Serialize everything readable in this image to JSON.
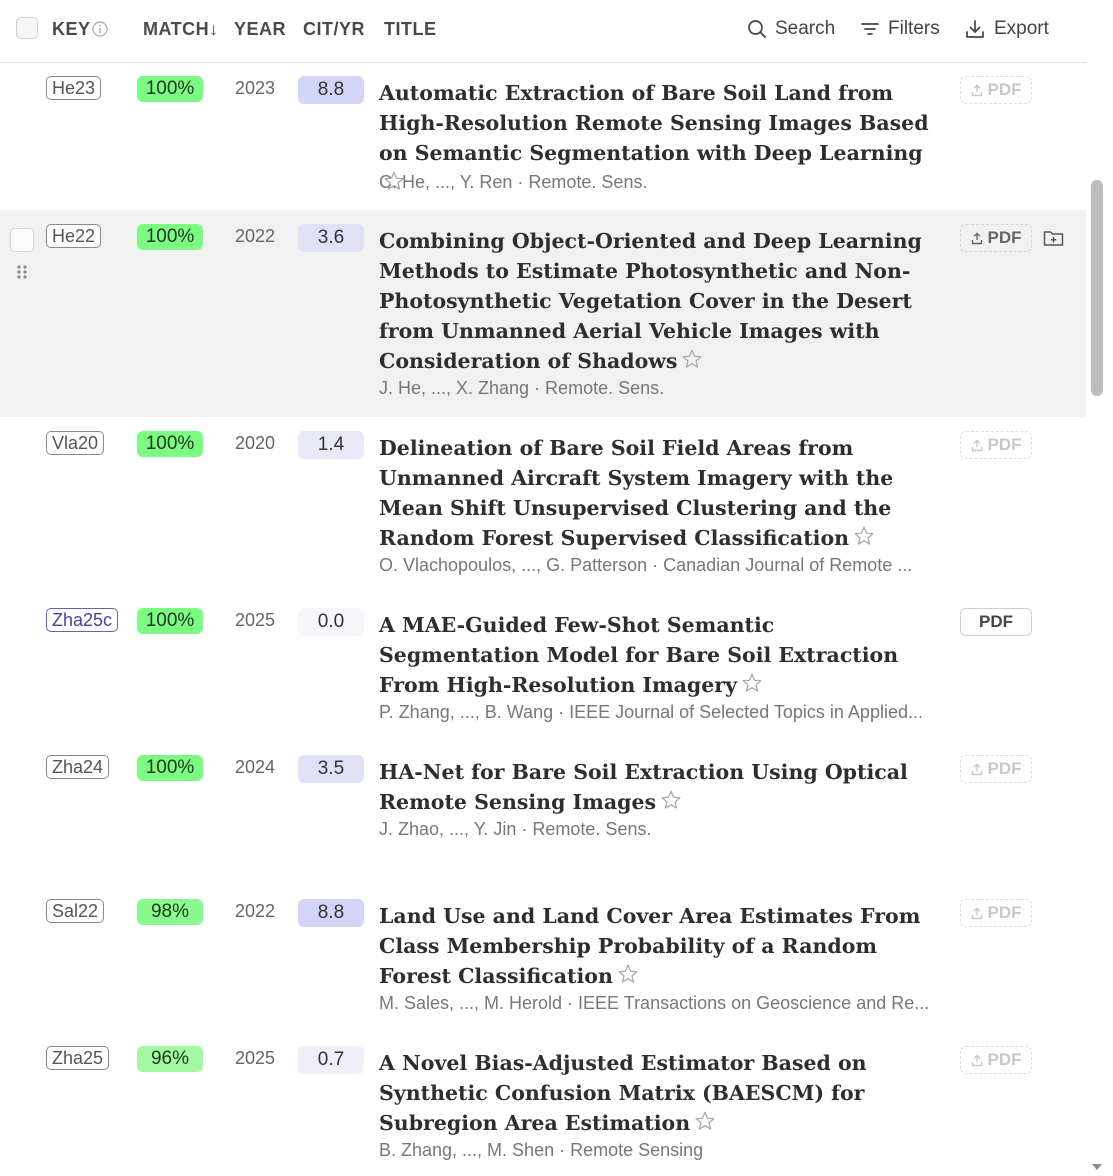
{
  "header": {
    "columns": {
      "key": "KEY",
      "match": "MATCH↓",
      "year": "YEAR",
      "cit": "CIT/YR",
      "title": "TITLE"
    },
    "tools": {
      "search": "Search",
      "filters": "Filters",
      "export": "Export"
    }
  },
  "rows": [
    {
      "key": "He23",
      "match": "100%",
      "year": "2023",
      "cit": "8.8",
      "title": "Automatic Extraction of Bare Soil Land from High-Resolution Remote Sensing Images Based on Semantic Segmentation with Deep Learning",
      "meta": "C. He, ..., Y. Ren · Remote. Sens.",
      "pdf": "PDF"
    },
    {
      "key": "He22",
      "match": "100%",
      "year": "2022",
      "cit": "3.6",
      "title": "Combining Object-Oriented and Deep Learning Methods to Estimate Photosynthetic and Non-Photosynthetic Vegetation Cover in the Desert from Unmanned Aerial Vehicle Images with Consideration of Shadows",
      "meta": "J. He, ..., X. Zhang · Remote. Sens.",
      "pdf": "PDF"
    },
    {
      "key": "Vla20",
      "match": "100%",
      "year": "2020",
      "cit": "1.4",
      "title": "Delineation of Bare Soil Field Areas from Unmanned Aircraft System Imagery with the Mean Shift Unsupervised Clustering and the Random Forest Supervised Classification",
      "meta": "O. Vlachopoulos, ..., G. Patterson · Canadian Journal of Remote ...",
      "pdf": "PDF"
    },
    {
      "key": "Zha25c",
      "match": "100%",
      "year": "2025",
      "cit": "0.0",
      "title": "A MAE-Guided Few-Shot Semantic Segmentation Model for Bare Soil Extraction From High-Resolution Imagery",
      "meta": "P. Zhang, ..., B. Wang · IEEE Journal of Selected Topics in Applied...",
      "pdf": "PDF"
    },
    {
      "key": "Zha24",
      "match": "100%",
      "year": "2024",
      "cit": "3.5",
      "title": "HA-Net for Bare Soil Extraction Using Optical Remote Sensing Images",
      "meta": "J. Zhao, ..., Y. Jin · Remote. Sens.",
      "pdf": "PDF"
    },
    {
      "key": "Sal22",
      "match": "98%",
      "year": "2022",
      "cit": "8.8",
      "title": "Land Use and Land Cover Area Estimates From Class Membership Probability of a Random Forest Classification",
      "meta": "M. Sales, ..., M. Herold · IEEE Transactions on Geoscience and Re...",
      "pdf": "PDF"
    },
    {
      "key": "Zha25",
      "match": "96%",
      "year": "2025",
      "cit": "0.7",
      "title": "A Novel Bias-Adjusted Estimator Based on Synthetic Confusion Matrix (BAESCM) for Subregion Area Estimation",
      "meta": "B. Zhang, ..., M. Shen · Remote Sensing",
      "pdf": "PDF"
    }
  ],
  "colors": {
    "match_100": "#7dfa83",
    "match_98": "#8afa8f",
    "match_96": "#a4f8a3",
    "cit_high": "#d4d5f6",
    "cit_mid": "#e0e0f6",
    "cit_low": "#efeff8",
    "cit_zero": "#f6f6fb"
  }
}
